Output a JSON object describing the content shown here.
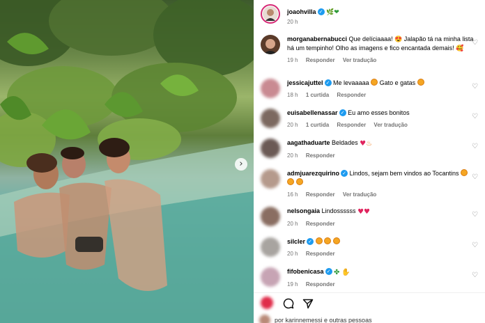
{
  "post": {
    "author": "joaohvilla",
    "author_suffix": "🌿❤",
    "time": "20 h",
    "next_arrow": "›"
  },
  "comments": [
    {
      "user": "morganabernabucci",
      "verified": false,
      "text": "Que delíciaaaa! 😍 Jalapão tá na minha lista há um tempinho! Olho as imagens e fico encantada demais! 🥰",
      "time": "19 h",
      "likes": "",
      "reply": "Responder",
      "translate": "Ver tradução",
      "avatar_color": "#5a3b2a"
    },
    {
      "user": "jessicajuttel",
      "verified": true,
      "text": "Me levaaaaa",
      "text2": "Gato e gatas",
      "time": "18 h",
      "likes": "1 curtida",
      "reply": "Responder",
      "translate": "",
      "avatar_color": "#c98a92"
    },
    {
      "user": "euisabellenassar",
      "verified": true,
      "text": "Eu amo esses bonitos",
      "time": "20 h",
      "likes": "1 curtida",
      "reply": "Responder",
      "translate": "Ver tradução",
      "avatar_color": "#7c6960"
    },
    {
      "user": "aagathaduarte",
      "verified": false,
      "text": "Beldades",
      "time": "20 h",
      "likes": "",
      "reply": "Responder",
      "translate": "",
      "avatar_color": "#6b5a55"
    },
    {
      "user": "admjuarezquirino",
      "verified": true,
      "text": "Lindos, sejam bem vindos ao Tocantins",
      "time": "16 h",
      "likes": "",
      "reply": "Responder",
      "translate": "Ver tradução",
      "avatar_color": "#b59a8c"
    },
    {
      "user": "nelsongaia",
      "verified": false,
      "text": "Lindossssss",
      "time": "20 h",
      "likes": "",
      "reply": "Responder",
      "translate": "",
      "avatar_color": "#8a6e62"
    },
    {
      "user": "silcler",
      "verified": true,
      "text": "",
      "time": "20 h",
      "likes": "",
      "reply": "Responder",
      "translate": "",
      "avatar_color": "#a8a4a0"
    },
    {
      "user": "fifobenicasa",
      "verified": true,
      "text": "",
      "time": "19 h",
      "likes": "",
      "reply": "Responder",
      "translate": "",
      "avatar_color": "#c7a4b4"
    }
  ],
  "footer": {
    "liked_by": "por karinnemessi e outras pessoas"
  },
  "colors": {
    "verified": "#1d9bf0",
    "meta_text": "#737373",
    "story_ring": "#d62976"
  }
}
